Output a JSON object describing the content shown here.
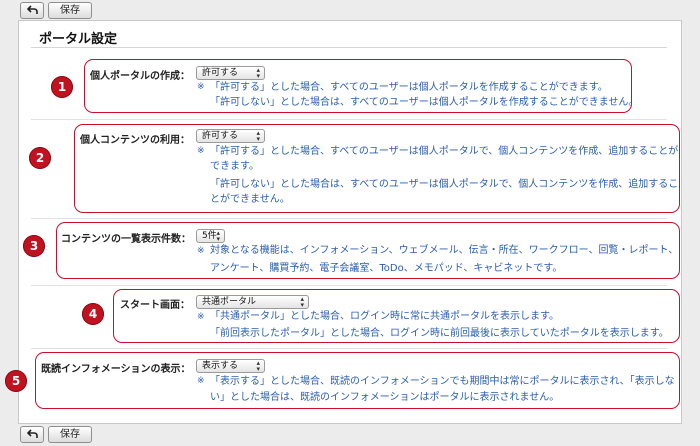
{
  "toolbar": {
    "back_icon": "back-arrow-icon",
    "save_label": "保存"
  },
  "page": {
    "title": "ポータル設定"
  },
  "note_mark": "※",
  "colors": {
    "callout": "#c8102e",
    "badge": "#c1121f",
    "note_text": "#2a5db0"
  },
  "sections": [
    {
      "badge": "1",
      "label": "個人ポータルの作成：",
      "select": "許可する",
      "notes": [
        "「許可する」とした場合、すべてのユーザーは個人ポータルを作成することができます。",
        "「許可しない」とした場合は、すべてのユーザーは個人ポータルを作成することができません。"
      ]
    },
    {
      "badge": "2",
      "label": "個人コンテンツの利用：",
      "select": "許可する",
      "notes": [
        "「許可する」とした場合、すべてのユーザーは個人ポータルで、個人コンテンツを作成、追加することが",
        "できます。",
        "「許可しない」とした場合は、すべてのユーザーは個人ポータルで、個人コンテンツを作成、追加するこ",
        "とができません。"
      ]
    },
    {
      "badge": "3",
      "label": "コンテンツの一覧表示件数：",
      "select": "5件",
      "notes": [
        "対象となる機能は、インフォメーション、ウェブメール、伝言・所在、ワークフロー、回覧・レポート、",
        "アンケート、購買予約、電子会議室、ToDo、メモパッド、キャビネットです。"
      ]
    },
    {
      "badge": "4",
      "label": "スタート画面：",
      "select": "共通ポータル",
      "notes": [
        "「共通ポータル」とした場合、ログイン時に常に共通ポータルを表示します。",
        "「前回表示したポータル」とした場合、ログイン時に前回最後に表示していたポータルを表示します。"
      ]
    },
    {
      "badge": "5",
      "label": "既読インフォメーションの表示：",
      "select": "表示する",
      "notes": [
        "「表示する」とした場合、既読のインフォメーションでも期間中は常にポータルに表示され、「表示しな",
        "い」とした場合は、既読のインフォメーションはポータルに表示されません。"
      ]
    }
  ]
}
